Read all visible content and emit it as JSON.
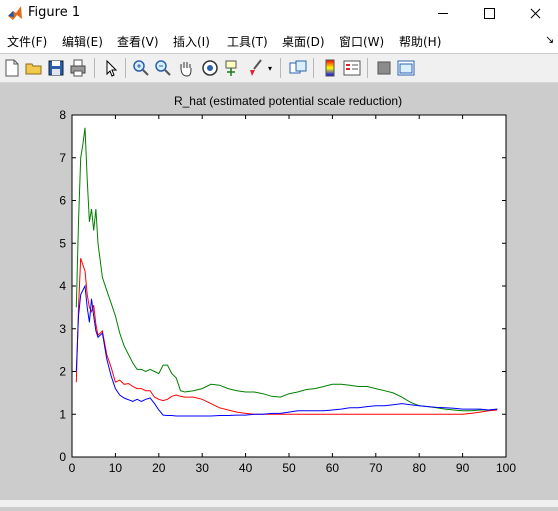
{
  "window": {
    "title": "Figure 1"
  },
  "menu": [
    {
      "label": "文件(F)"
    },
    {
      "label": "编辑(E)"
    },
    {
      "label": "查看(V)"
    },
    {
      "label": "插入(I)"
    },
    {
      "label": "工具(T)"
    },
    {
      "label": "桌面(D)"
    },
    {
      "label": "窗口(W)"
    },
    {
      "label": "帮助(H)"
    }
  ],
  "toolbar_icons": [
    "new-figure-icon",
    "open-icon",
    "save-icon",
    "print-icon",
    "pointer-icon",
    "zoom-in-icon",
    "zoom-out-icon",
    "pan-icon",
    "rotate-3d-icon",
    "data-cursor-icon",
    "brush-icon",
    "link-plot-icon",
    "colorbar-icon",
    "legend-icon",
    "hide-plot-tools-icon",
    "show-plot-tools-icon"
  ],
  "chart_data": {
    "type": "line",
    "title": "R_hat (estimated potential scale reduction)",
    "xlim": [
      0,
      100
    ],
    "ylim": [
      0,
      8
    ],
    "xticks": [
      "0",
      "10",
      "20",
      "30",
      "40",
      "50",
      "60",
      "70",
      "80",
      "90",
      "100"
    ],
    "yticks": [
      "0",
      "1",
      "2",
      "3",
      "4",
      "5",
      "6",
      "7",
      "8"
    ],
    "grid": false,
    "series": [
      {
        "color": "#007f00",
        "x": [
          1,
          1.5,
          2,
          2.5,
          3,
          3.5,
          4,
          4.5,
          5,
          5.5,
          6,
          7,
          8,
          9,
          10,
          11,
          12,
          13,
          14,
          15,
          16,
          17,
          18,
          19,
          20,
          21,
          22,
          23,
          24,
          25,
          26,
          28,
          30,
          32,
          34,
          36,
          38,
          40,
          42,
          44,
          46,
          48,
          50,
          52,
          54,
          56,
          58,
          60,
          62,
          64,
          66,
          68,
          70,
          72,
          74,
          76,
          78,
          80,
          82,
          84,
          86,
          88,
          90,
          92,
          94,
          96,
          98
        ],
        "y": [
          3.5,
          5.5,
          7.0,
          7.3,
          7.7,
          6.5,
          5.5,
          5.8,
          5.3,
          5.8,
          5.0,
          4.2,
          3.9,
          3.6,
          3.3,
          2.9,
          2.6,
          2.4,
          2.2,
          2.05,
          2.05,
          2.0,
          2.05,
          2.0,
          1.95,
          2.15,
          2.15,
          1.95,
          1.85,
          1.55,
          1.52,
          1.55,
          1.6,
          1.7,
          1.68,
          1.6,
          1.55,
          1.52,
          1.52,
          1.48,
          1.42,
          1.4,
          1.48,
          1.52,
          1.58,
          1.6,
          1.65,
          1.7,
          1.7,
          1.68,
          1.65,
          1.65,
          1.6,
          1.55,
          1.5,
          1.4,
          1.28,
          1.2,
          1.18,
          1.15,
          1.12,
          1.1,
          1.08,
          1.08,
          1.1,
          1.1,
          1.12
        ]
      },
      {
        "color": "#ff0000",
        "x": [
          1,
          1.5,
          2,
          2.5,
          3,
          3.5,
          4,
          4.5,
          5,
          5.5,
          6,
          7,
          8,
          9,
          10,
          11,
          12,
          13,
          14,
          15,
          16,
          17,
          18,
          19,
          20,
          21,
          22,
          23,
          24,
          25,
          26,
          28,
          30,
          32,
          34,
          36,
          38,
          40,
          42,
          44,
          46,
          48,
          50,
          52,
          54,
          56,
          58,
          60,
          62,
          64,
          66,
          68,
          70,
          72,
          74,
          76,
          78,
          80,
          82,
          84,
          86,
          88,
          90,
          92,
          94,
          96,
          98
        ],
        "y": [
          1.75,
          3.5,
          4.65,
          4.5,
          4.35,
          3.8,
          3.5,
          3.4,
          3.55,
          3.1,
          2.85,
          2.95,
          2.4,
          2.1,
          1.75,
          1.8,
          1.7,
          1.72,
          1.65,
          1.6,
          1.6,
          1.55,
          1.55,
          1.4,
          1.35,
          1.32,
          1.35,
          1.42,
          1.45,
          1.42,
          1.4,
          1.4,
          1.35,
          1.25,
          1.15,
          1.1,
          1.05,
          1.02,
          1.0,
          1.0,
          1.0,
          1.0,
          1.0,
          1.0,
          1.0,
          1.0,
          1.0,
          1.0,
          1.0,
          1.0,
          1.0,
          1.0,
          1.0,
          1.0,
          1.0,
          1.0,
          1.0,
          1.0,
          1.0,
          1.0,
          1.0,
          1.0,
          1.0,
          1.02,
          1.05,
          1.08,
          1.1
        ]
      },
      {
        "color": "#0000ff",
        "x": [
          1,
          1.5,
          2,
          2.5,
          3,
          3.5,
          4,
          4.5,
          5,
          5.5,
          6,
          7,
          8,
          9,
          10,
          11,
          12,
          13,
          14,
          15,
          16,
          17,
          18,
          19,
          20,
          21,
          22,
          23,
          24,
          25,
          26,
          28,
          30,
          32,
          34,
          36,
          38,
          40,
          42,
          44,
          46,
          48,
          50,
          52,
          54,
          56,
          58,
          60,
          62,
          64,
          66,
          68,
          70,
          72,
          74,
          76,
          78,
          80,
          82,
          84,
          86,
          88,
          90,
          92,
          94,
          96,
          98
        ],
        "y": [
          2.0,
          3.3,
          3.8,
          3.9,
          4.0,
          3.5,
          3.15,
          3.7,
          3.3,
          2.95,
          2.8,
          2.9,
          2.3,
          1.9,
          1.6,
          1.45,
          1.38,
          1.34,
          1.3,
          1.35,
          1.3,
          1.35,
          1.38,
          1.25,
          1.1,
          0.98,
          0.97,
          0.97,
          0.96,
          0.96,
          0.96,
          0.96,
          0.96,
          0.96,
          0.97,
          0.97,
          0.98,
          0.98,
          1.0,
          1.0,
          1.02,
          1.02,
          1.05,
          1.08,
          1.08,
          1.08,
          1.08,
          1.1,
          1.12,
          1.15,
          1.15,
          1.18,
          1.2,
          1.2,
          1.22,
          1.25,
          1.22,
          1.2,
          1.18,
          1.16,
          1.15,
          1.14,
          1.12,
          1.12,
          1.12,
          1.1,
          1.12
        ]
      }
    ]
  }
}
